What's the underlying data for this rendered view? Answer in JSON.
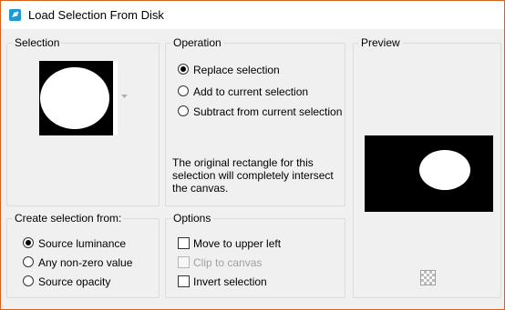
{
  "window": {
    "title": "Load Selection From Disk",
    "accent_border": "#d9611c"
  },
  "selection_group": {
    "legend": "Selection",
    "dropdown_arrow_icon": "chevron-down-icon"
  },
  "operation_group": {
    "legend": "Operation",
    "options": [
      {
        "label": "Replace selection",
        "checked": true
      },
      {
        "label": "Add to current selection",
        "checked": false
      },
      {
        "label": "Subtract from current selection",
        "checked": false
      }
    ],
    "info": "The original rectangle for this selection will completely intersect the canvas."
  },
  "preview_group": {
    "legend": "Preview",
    "transparency_icon": "checkerboard-icon"
  },
  "create_group": {
    "legend": "Create selection from:",
    "options": [
      {
        "label": "Source luminance",
        "checked": true
      },
      {
        "label": "Any non-zero value",
        "checked": false
      },
      {
        "label": "Source opacity",
        "checked": false
      }
    ]
  },
  "options_group": {
    "legend": "Options",
    "items": [
      {
        "label": "Move to upper left",
        "checked": false,
        "enabled": true
      },
      {
        "label": "Clip to canvas",
        "checked": false,
        "enabled": false
      },
      {
        "label": "Invert selection",
        "checked": false,
        "enabled": true
      }
    ]
  }
}
